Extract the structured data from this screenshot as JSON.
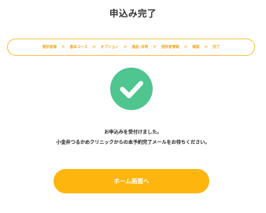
{
  "page": {
    "title": "申込み完了"
  },
  "steps": [
    {
      "label": "受診者様"
    },
    {
      "label": "基本コース"
    },
    {
      "label": "オプション"
    },
    {
      "label": "施設･日時"
    },
    {
      "label": "受診者情報"
    },
    {
      "label": "確認"
    },
    {
      "label": "完了"
    }
  ],
  "step_separator": ">",
  "success_icon": "check-circle-icon",
  "message": {
    "line1": "お申込みを受付けました。",
    "line2": "小金井つるかめクリニックからの本予約完了メールをお待ちください。"
  },
  "home_button": {
    "label": "ホーム画面へ"
  },
  "colors": {
    "accent": "#fdb60d",
    "step_text": "#eba826",
    "step_border": "#f7c04a",
    "success": "#4fc58f"
  }
}
